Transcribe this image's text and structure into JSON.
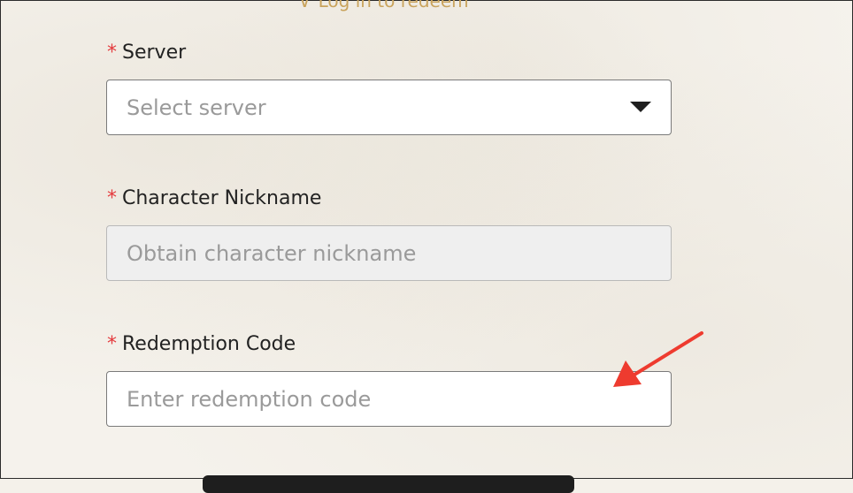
{
  "login_prompt": {
    "chevron_icon": "chevron-down-icon",
    "label": "Log in to redeem"
  },
  "form": {
    "required_mark": "*",
    "server": {
      "label": "Server",
      "placeholder": "Select server",
      "dropdown_icon": "caret-down-icon"
    },
    "nickname": {
      "label": "Character Nickname",
      "placeholder": "Obtain character nickname",
      "disabled": true
    },
    "redemption_code": {
      "label": "Redemption Code",
      "placeholder": "Enter redemption code"
    }
  },
  "annotation": {
    "icon": "arrow-icon",
    "color": "#ee3b2f"
  },
  "colors": {
    "required": "#e4393c",
    "link": "#c9a35c",
    "placeholder": "#9a9a9a"
  }
}
